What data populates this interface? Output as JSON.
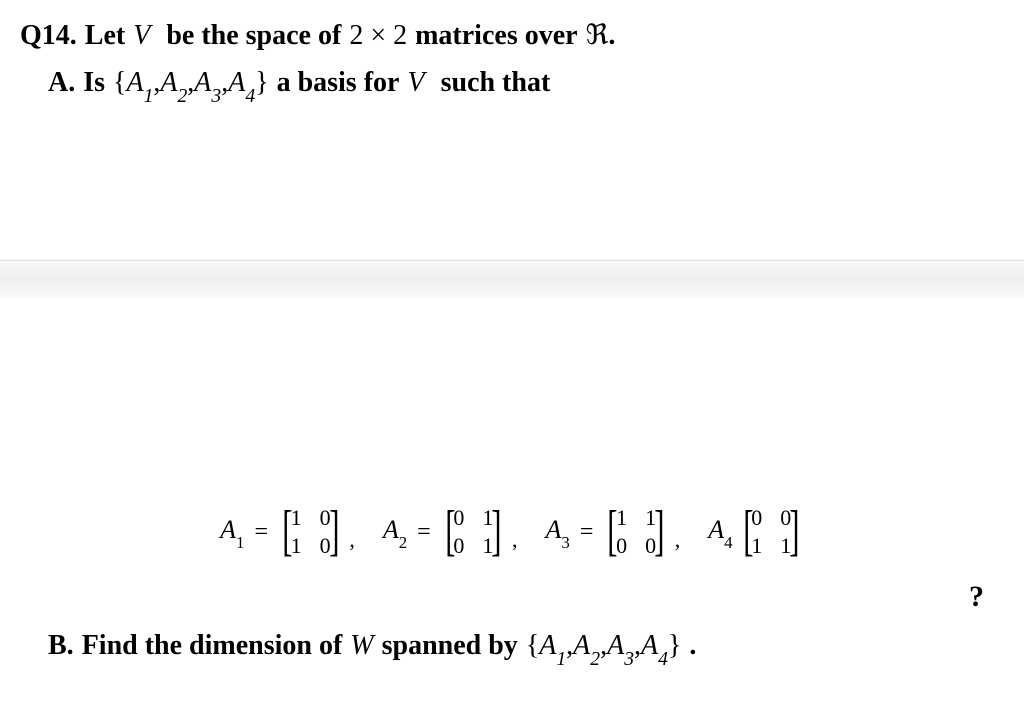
{
  "question": {
    "number": "Q14.",
    "intro_1": "Let",
    "space_var": "V",
    "intro_2": "be the space of",
    "dim": "2 × 2",
    "intro_3": "matrices over",
    "field": "ℜ",
    "period": "."
  },
  "partA": {
    "label": "A.",
    "word_is": "Is",
    "set_open": "{",
    "a1": "A",
    "s1": "1",
    "comma1": ",",
    "a2": "A",
    "s2": "2",
    "comma2": ",",
    "a3": "A",
    "s3": "3",
    "comma3": ",",
    "a4": "A",
    "s4": "4",
    "set_close": "}",
    "tail1": "a basis for",
    "space_var": "V",
    "tail2": "such that"
  },
  "matrices": {
    "A1": {
      "label": "A",
      "sub": "1",
      "cells": [
        "1",
        "0",
        "1",
        "0"
      ]
    },
    "A2": {
      "label": "A",
      "sub": "2",
      "cells": [
        "0",
        "1",
        "0",
        "1"
      ]
    },
    "A3": {
      "label": "A",
      "sub": "3",
      "cells": [
        "1",
        "1",
        "0",
        "0"
      ]
    },
    "A4": {
      "label": "A",
      "sub": "4",
      "cells": [
        "0",
        "0",
        "1",
        "1"
      ]
    },
    "eq": "=",
    "lbracket": "[",
    "rbracket": "]",
    "comma": ","
  },
  "qmark": "?",
  "partB": {
    "label": "B.",
    "text1": "Find the dimension of",
    "W": "W",
    "text2": "spanned by",
    "set_open": "{",
    "a1": "A",
    "s1": "1",
    "c1": ",",
    "a2": "A",
    "s2": "2",
    "c2": ",",
    "a3": "A",
    "s3": "3",
    "c3": ",",
    "a4": "A",
    "s4": "4",
    "set_close": "}",
    "period": "."
  }
}
